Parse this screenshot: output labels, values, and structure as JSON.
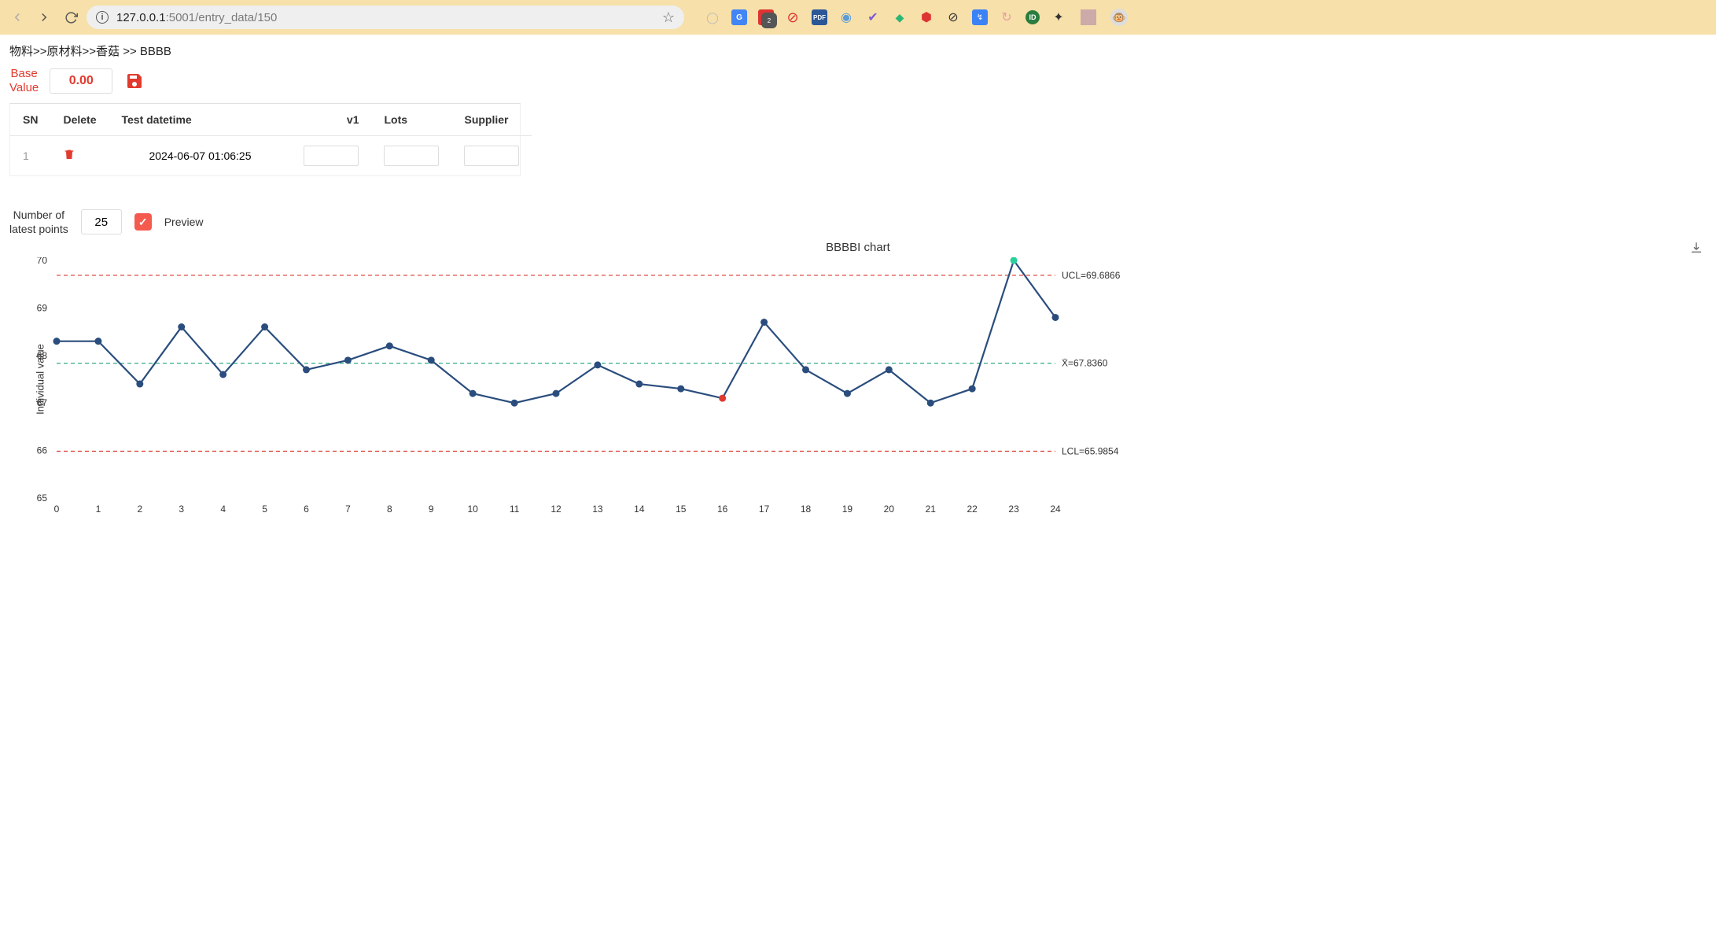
{
  "browser": {
    "url_host": "127.0.0.1",
    "url_path": ":5001/entry_data/150"
  },
  "breadcrumb": "物料>>原材料>>香菇  >>  BBBB",
  "base_value": {
    "label_line1": "Base",
    "label_line2": "Value",
    "value": "0.00"
  },
  "table": {
    "headers": {
      "sn": "SN",
      "delete": "Delete",
      "dt": "Test datetime",
      "v1": "v1",
      "lots": "Lots",
      "supplier": "Supplier"
    },
    "rows": [
      {
        "sn": "1",
        "datetime": "2024-06-07 01:06:25",
        "v1": "",
        "lots": "",
        "supplier": ""
      }
    ]
  },
  "points": {
    "label_line1": "Number of",
    "label_line2": "latest points",
    "value": "25",
    "preview_label": "Preview"
  },
  "chart": {
    "title": "BBBBI chart",
    "ylabel": "Individual value",
    "ucl_label": "UCL=69.6866",
    "mean_label": "X̄=67.8360",
    "lcl_label": "LCL=65.9854"
  },
  "chart_data": {
    "type": "line",
    "title": "BBBBI chart",
    "xlabel": "",
    "ylabel": "Individual value",
    "ylim": [
      65,
      70
    ],
    "xlim": [
      0,
      24
    ],
    "ucl": 69.6866,
    "mean": 67.836,
    "lcl": 65.9854,
    "x": [
      0,
      1,
      2,
      3,
      4,
      5,
      6,
      7,
      8,
      9,
      10,
      11,
      12,
      13,
      14,
      15,
      16,
      17,
      18,
      19,
      20,
      21,
      22,
      23,
      24
    ],
    "values": [
      68.3,
      68.3,
      67.4,
      68.6,
      67.6,
      68.6,
      67.7,
      67.9,
      68.2,
      67.9,
      67.2,
      67.0,
      67.2,
      67.8,
      67.4,
      67.3,
      67.1,
      68.7,
      67.7,
      67.2,
      67.7,
      67.0,
      67.3,
      70.0,
      68.8
    ],
    "point_flags": {
      "red_indices": [
        16
      ],
      "green_indices": [
        23
      ]
    }
  }
}
